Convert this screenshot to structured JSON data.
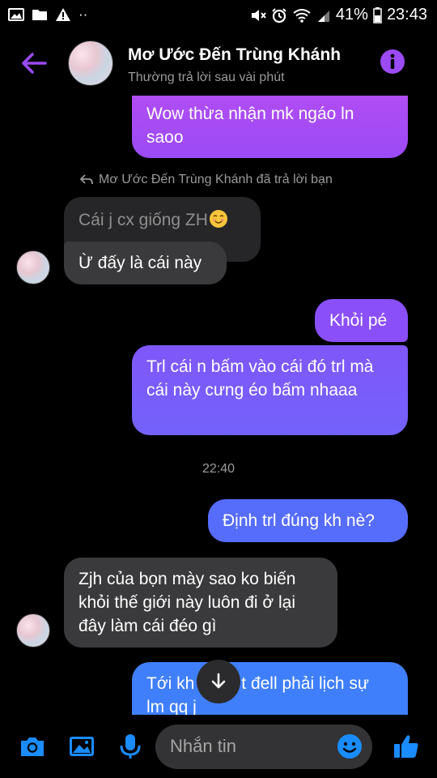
{
  "status_bar": {
    "left_icons": [
      "image-icon",
      "folder-icon",
      "warning-icon",
      "more-dots-icon"
    ],
    "battery": "41%",
    "time": "23:43"
  },
  "header": {
    "name": "Mơ Ước Đến Trùng Khánh",
    "subtitle": "Thường trả lời sau vài phút"
  },
  "messages": {
    "m1": "Wow thừa nhận mk ngáo ln saoo",
    "reply_note": "Mơ Ước Đến Trùng Khánh đã trả lời bạn",
    "m2": "Cái j cx giống ZH",
    "m3": "Ừ đấy là cái này",
    "m4": "Khỏi pé",
    "m5": "Trl cái n bấm vào cái đó trl mà cái này cưng éo bấm nhaaa",
    "timestamp": "22:40",
    "m6": "Định trl đúng kh nè?",
    "m7": "Zjh của bọn mày sao ko biến khỏi thế giới này luôn đi ở lại đây làm cái đéo gì",
    "m8_left": "Tới kh",
    "m8_right": "t đell phải lịch sự",
    "m8_line2": "lm qq j"
  },
  "composer": {
    "placeholder": "Nhắn tin"
  },
  "colors": {
    "accent": "#8b4ff8",
    "sent_top": "#b14cf3",
    "sent_bottom": "#3f7ffb",
    "received": "#3a3a3c",
    "composer_icons": "#1a8cff"
  }
}
